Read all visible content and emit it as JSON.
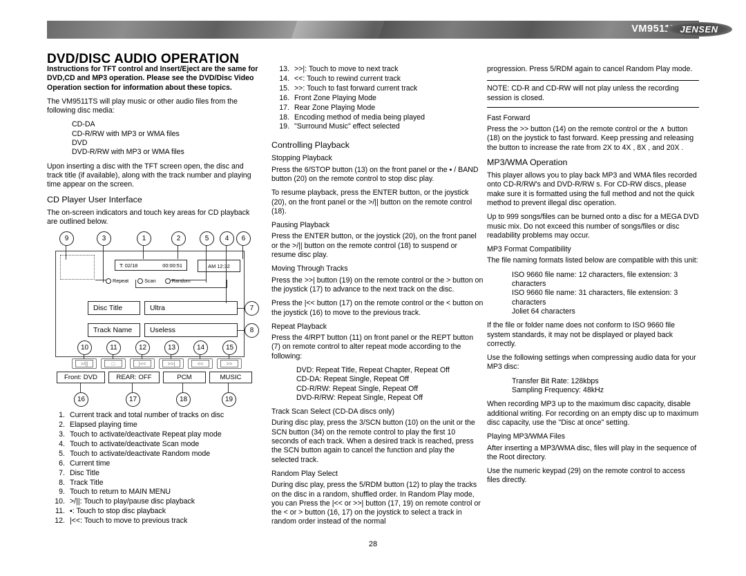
{
  "header": {
    "model": "VM9511TS",
    "logo_text": "JENSEN"
  },
  "page_title": "DVD/DISC AUDIO OPERATION",
  "page_number": "28",
  "col1": {
    "intro_bold": "Instructions for TFT control and Insert/Eject are the same for DVD,CD and MP3 operation. Please see the DVD/Disc Video Operation section for information about these topics.",
    "para_media": "The VM9511TS will play music or other audio files from the following disc media:",
    "media_list": [
      "CD-DA",
      "CD-R/RW with MP3 or WMA files",
      "DVD",
      "DVD-R/RW with MP3 or WMA files"
    ],
    "para_insert": "Upon inserting a disc with the TFT screen open, the disc and track title (if available), along with the track number and playing time appear on the screen.",
    "heading_ui": "CD Player User Interface",
    "para_ui": "The on-screen indicators and touch key areas for CD playback are outlined below.",
    "diagram": {
      "time_track": "T: 02/18",
      "time_elapsed": "00:00:51",
      "clock": "AM 12:32",
      "mode_repeat": "Repeat",
      "mode_scan": "Scan",
      "mode_random": "Random",
      "disc_title_label": "Disc Title",
      "disc_title_value": "Ultra",
      "track_name_label": "Track Name",
      "track_name_value": "Useless",
      "key_play": ">/||",
      "key_stop": "□",
      "key_prev": "|<<",
      "key_next": ">>|",
      "key_rew": "<<",
      "key_ff": ">>",
      "status_front": "Front: DVD",
      "status_rear": "REAR: OFF",
      "status_pcm": "PCM",
      "status_music": "MUSIC",
      "callouts": [
        "9",
        "3",
        "1",
        "2",
        "5",
        "4",
        "6",
        "7",
        "8",
        "10",
        "11",
        "12",
        "13",
        "14",
        "15",
        "16",
        "17",
        "18",
        "19"
      ]
    },
    "numbered_items": [
      {
        "n": "1.",
        "text": "Current track and total number of tracks on disc"
      },
      {
        "n": "2.",
        "text": "Elapsed playing time"
      },
      {
        "n": "3.",
        "text": "Touch to activate/deactivate Repeat play mode"
      },
      {
        "n": "4.",
        "text": "Touch to activate/deactivate Scan mode"
      },
      {
        "n": "5.",
        "text": "Touch to activate/deactivate Random mode"
      },
      {
        "n": "6.",
        "text": "Current time"
      },
      {
        "n": "7.",
        "text": "Disc Title"
      },
      {
        "n": "8.",
        "text": "Track Title"
      },
      {
        "n": "9.",
        "text": "Touch to return to MAIN MENU"
      },
      {
        "n": "10.",
        "text": ">/||: Touch to play/pause disc playback"
      },
      {
        "n": "11.",
        "text": "▪: Touch to stop disc playback"
      },
      {
        "n": "12.",
        "text": "|<<: Touch to move to previous track"
      }
    ]
  },
  "col2": {
    "numbered_items": [
      {
        "n": "13.",
        "text": ">>|: Touch to move to next track"
      },
      {
        "n": "14.",
        "text": "<<: Touch to rewind current track"
      },
      {
        "n": "15.",
        "text": ">>: Touch to fast forward current track"
      },
      {
        "n": "16.",
        "text": "Front Zone Playing Mode"
      },
      {
        "n": "17.",
        "text": "Rear Zone Playing Mode"
      },
      {
        "n": "18.",
        "text": "Encoding method of media being played"
      },
      {
        "n": "19.",
        "text": "\"Surround Music\" effect selected"
      }
    ],
    "heading_controlling": "Controlling Playback",
    "sub_stopping": "Stopping Playback",
    "para_stop1": "Press the 6/STOP button (13) on the front panel or the ▪ / BAND  button (20) on the remote control to stop disc play.",
    "para_stop2": "To resume playback, press the ENTER button, or the joystick (20), on the front panel or the >/|| button on the remote control (18).",
    "sub_pausing": "Pausing Playback",
    "para_pause": "Press the ENTER button, or the joystick (20), on the front panel or the >/|| button on the remote control (18) to suspend or resume disc play.",
    "sub_moving": "Moving Through Tracks",
    "para_move1": "Press the >>| button (19) on the remote control or the > button on the joystick (17) to advance to the next track on the disc.",
    "para_move2": "Press the |<< button (17) on the remote control or the < button on the joystick (16) to move to the previous track.",
    "sub_repeat": "Repeat Playback",
    "para_repeat": "Press the 4/RPT button (11) on front panel or the REPT button (7) on remote control to alter repeat mode according to the following:",
    "repeat_list": [
      "DVD: Repeat Title, Repeat Chapter, Repeat Off",
      "CD-DA: Repeat Single, Repeat Off",
      "CD-R/RW: Repeat Single, Repeat Off",
      "DVD-R/RW: Repeat Single, Repeat Off"
    ],
    "sub_scan": "Track Scan Select (CD-DA discs only)",
    "para_scan": "During disc play, press the 3/SCN button (10) on the unit or the SCN button (34) on the remote control to play the first 10 seconds of each track. When a desired track is reached, press the SCN button again to cancel the function and play the selected track.",
    "sub_random": "Random Play Select",
    "para_random": "During disc play, press the 5/RDM button (12) to play the tracks on the disc in a random, shuffled order. In Random Play mode, you can Press the |<< or >>| button (17, 19) on remote control or the < or > button (16, 17) on the joystick to select a track in random order instead of the normal"
  },
  "col3": {
    "para_random_cont": "progression. Press 5/RDM again to cancel Random Play mode.",
    "note": "NOTE: CD-R and CD-RW will not play unless the recording session is closed.",
    "sub_fastforward": "Fast Forward",
    "para_ff": "Press the >> button (14) on the remote control or the ∧ button (18) on the joystick to fast forward. Keep pressing and releasing the button to increase the rate from  2X  to  4X ,  8X , and  20X .",
    "heading_mp3wma": "MP3/WMA Operation",
    "para_mp3_1": "This player allows you to play back MP3 and WMA files recorded onto CD-R/RW's and DVD-R/RW s. For CD-RW discs, please make sure it is formatted using the full method and not the quick method to prevent illegal disc operation.",
    "para_mp3_2": "Up to 999 songs/files can be burned onto a disc for a MEGA DVD music mix. Do not exceed this number of songs/files or disc readability problems may occur.",
    "sub_format": "MP3 Format Compatibility",
    "para_format": "The file naming formats listed below are compatible with this unit:",
    "format_list": [
      "ISO 9660   file name: 12 characters, file extension: 3 characters",
      "ISO 9660   file name: 31 characters, file extension: 3 characters",
      "Joliet   64 characters"
    ],
    "para_conform": "If the file or folder name does not conform to ISO 9660 file system standards, it may not be displayed or played back correctly.",
    "para_settings": "Use the following settings when compressing audio data for your MP3 disc:",
    "settings_list": [
      "Transfer Bit Rate: 128kbps",
      "Sampling Frequency: 48kHz"
    ],
    "para_recording": "When recording MP3 up to the maximum disc capacity, disable additional writing. For recording on an empty disc up to maximum disc capacity, use the \"Disc at once\" setting.",
    "sub_playing": "Playing MP3/WMA Files",
    "para_playing1": "After inserting a MP3/WMA disc, files will play in the sequence of the  Root  directory.",
    "para_playing2": "Use the numeric keypad (29) on the remote control to access files directly."
  }
}
